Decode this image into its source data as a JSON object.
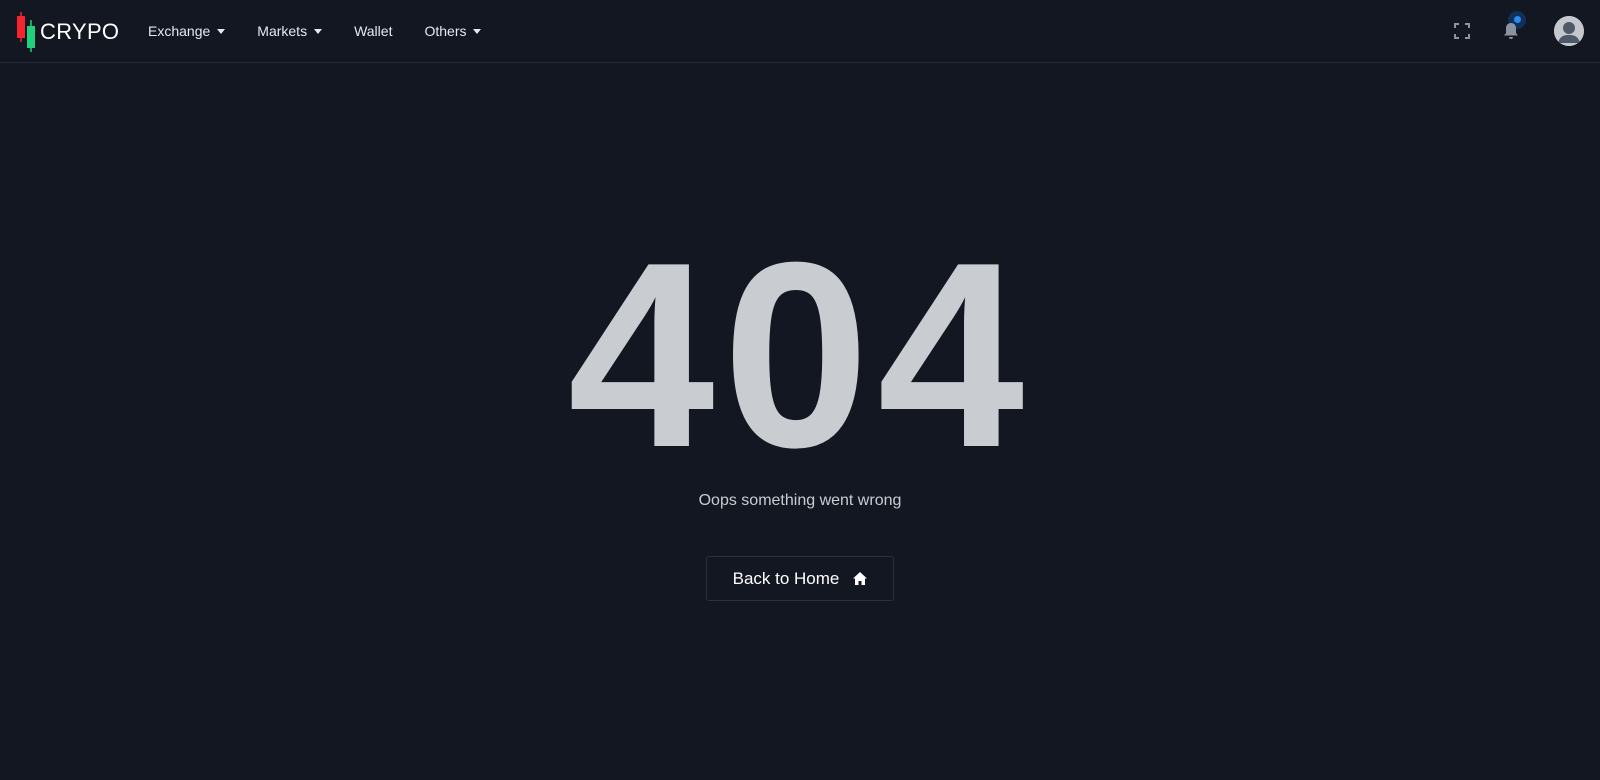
{
  "brand": {
    "name": "CRYPO",
    "candle_colors": [
      "#f6242e",
      "#21d07a"
    ]
  },
  "nav": {
    "items": [
      {
        "label": "Exchange",
        "has_dropdown": true
      },
      {
        "label": "Markets",
        "has_dropdown": true
      },
      {
        "label": "Wallet",
        "has_dropdown": false
      },
      {
        "label": "Others",
        "has_dropdown": true
      }
    ]
  },
  "header_icons": {
    "fullscreen": "fullscreen-icon",
    "notifications": "bell-icon",
    "notification_indicator_color": "#2a8af0",
    "profile": "avatar"
  },
  "error": {
    "code": "404",
    "message": "Oops something went wrong",
    "button_label": "Back to Home",
    "button_icon": "home-icon"
  }
}
